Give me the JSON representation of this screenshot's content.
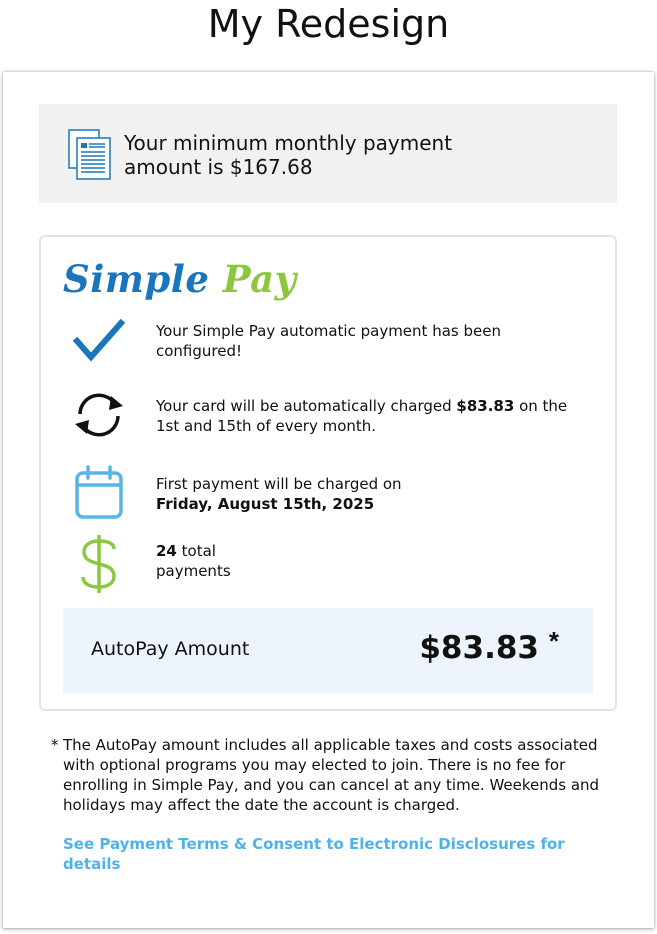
{
  "page": {
    "title": "My Redesign"
  },
  "minimum_payment": {
    "text": "Your minimum monthly payment amount is $167.68",
    "icon": "document-icon"
  },
  "simple_pay": {
    "brand_part1": "Simple",
    "brand_part2": "Pay",
    "brand_colors": {
      "primary": "#1a75bb",
      "secondary": "#8dc63f"
    },
    "items": [
      {
        "icon": "checkmark-icon",
        "text": "Your Simple Pay automatic payment has been configured!"
      },
      {
        "icon": "recurring-arrows-icon",
        "pre": "Your card will be automatically charged ",
        "bold": "$83.83",
        "post": " on the 1st and 15th of every month."
      },
      {
        "icon": "calendar-icon",
        "pre": "First payment will be charged on",
        "bold": "Friday, August 15th, 2025"
      },
      {
        "icon": "dollar-icon",
        "bold": "24",
        "post": " total payments"
      }
    ],
    "autopay": {
      "label": "AutoPay Amount",
      "value": "$83.83",
      "star": "*"
    }
  },
  "disclaimer": {
    "star": "*",
    "text": "The AutoPay amount includes all applicable taxes and costs associated with optional programs you may elected to join. There is no fee for enrolling in Simple Pay, and you can cancel at any time. Weekends and holidays may affect the date the account is charged."
  },
  "terms_link": "See Payment Terms & Consent to Electronic Disclosures for details",
  "colors": {
    "check": "#1a75bb",
    "calendar": "#5ab4e8",
    "dollar": "#8dc63f",
    "link": "#4fb3e8",
    "amount_bg": "#eef4fb",
    "notice_bg": "#f1f1f1"
  }
}
